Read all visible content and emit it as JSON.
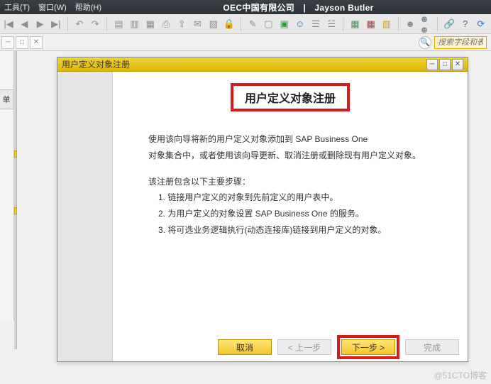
{
  "appbar": {
    "menu_tools": "工具(T)",
    "menu_window": "窗口(W)",
    "menu_help": "帮助(H)",
    "title": "OEC中国有限公司　|　Jayson Butler"
  },
  "subbar": {
    "search_placeholder": "搜索字段和表"
  },
  "leftpanel": {
    "tab_label": "单"
  },
  "wizard": {
    "title": "用户定义对象注册",
    "heading": "用户定义对象注册",
    "intro_line1": "使用该向导将新的用户定义对象添加到 SAP Business One",
    "intro_line2": "对象集合中，或者使用该向导更新、取消注册或删除现有用户定义对象。",
    "steps_title": "该注册包含以下主要步骤：",
    "step1": "1. 链接用户定义的对象到先前定义的用户表中。",
    "step2": "2. 为用户定义的对象设置 SAP Business One 的服务。",
    "step3": "3. 将可选业务逻辑执行(动态连接库)链接到用户定义的对象。",
    "btn_cancel": "取消",
    "btn_back": "< 上一步",
    "btn_next": "下一步 >",
    "btn_finish": "完成"
  },
  "watermark": "@51CTO博客"
}
